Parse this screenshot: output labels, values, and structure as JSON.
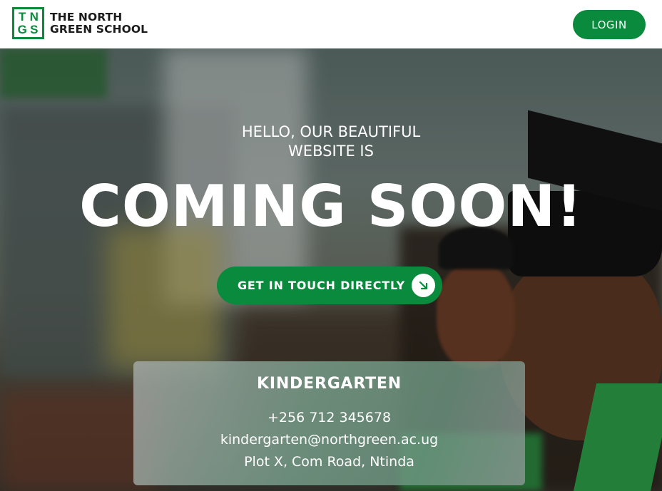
{
  "header": {
    "logo_letters": [
      "T",
      "N",
      "G",
      "S"
    ],
    "logo_line1": "THE NORTH",
    "logo_line2": "GREEN SCHOOL",
    "login_label": "LOGIN"
  },
  "hero": {
    "hello_line1": "HELLO, OUR BEAUTIFUL",
    "hello_line2": "WEBSITE IS",
    "headline": "COMING SOON!",
    "cta_label": "GET IN TOUCH DIRECTLY",
    "cta_icon": "arrow-down-right-icon"
  },
  "contact_card": {
    "title": "KINDERGARTEN",
    "phone": "+256 712 345678",
    "email": "kindergarten@northgreen.ac.ug",
    "address": "Plot X, Com Road, Ntinda"
  },
  "colors": {
    "brand_green": "#0a8a3c",
    "text_dark": "#1b1b1b",
    "white": "#ffffff"
  }
}
